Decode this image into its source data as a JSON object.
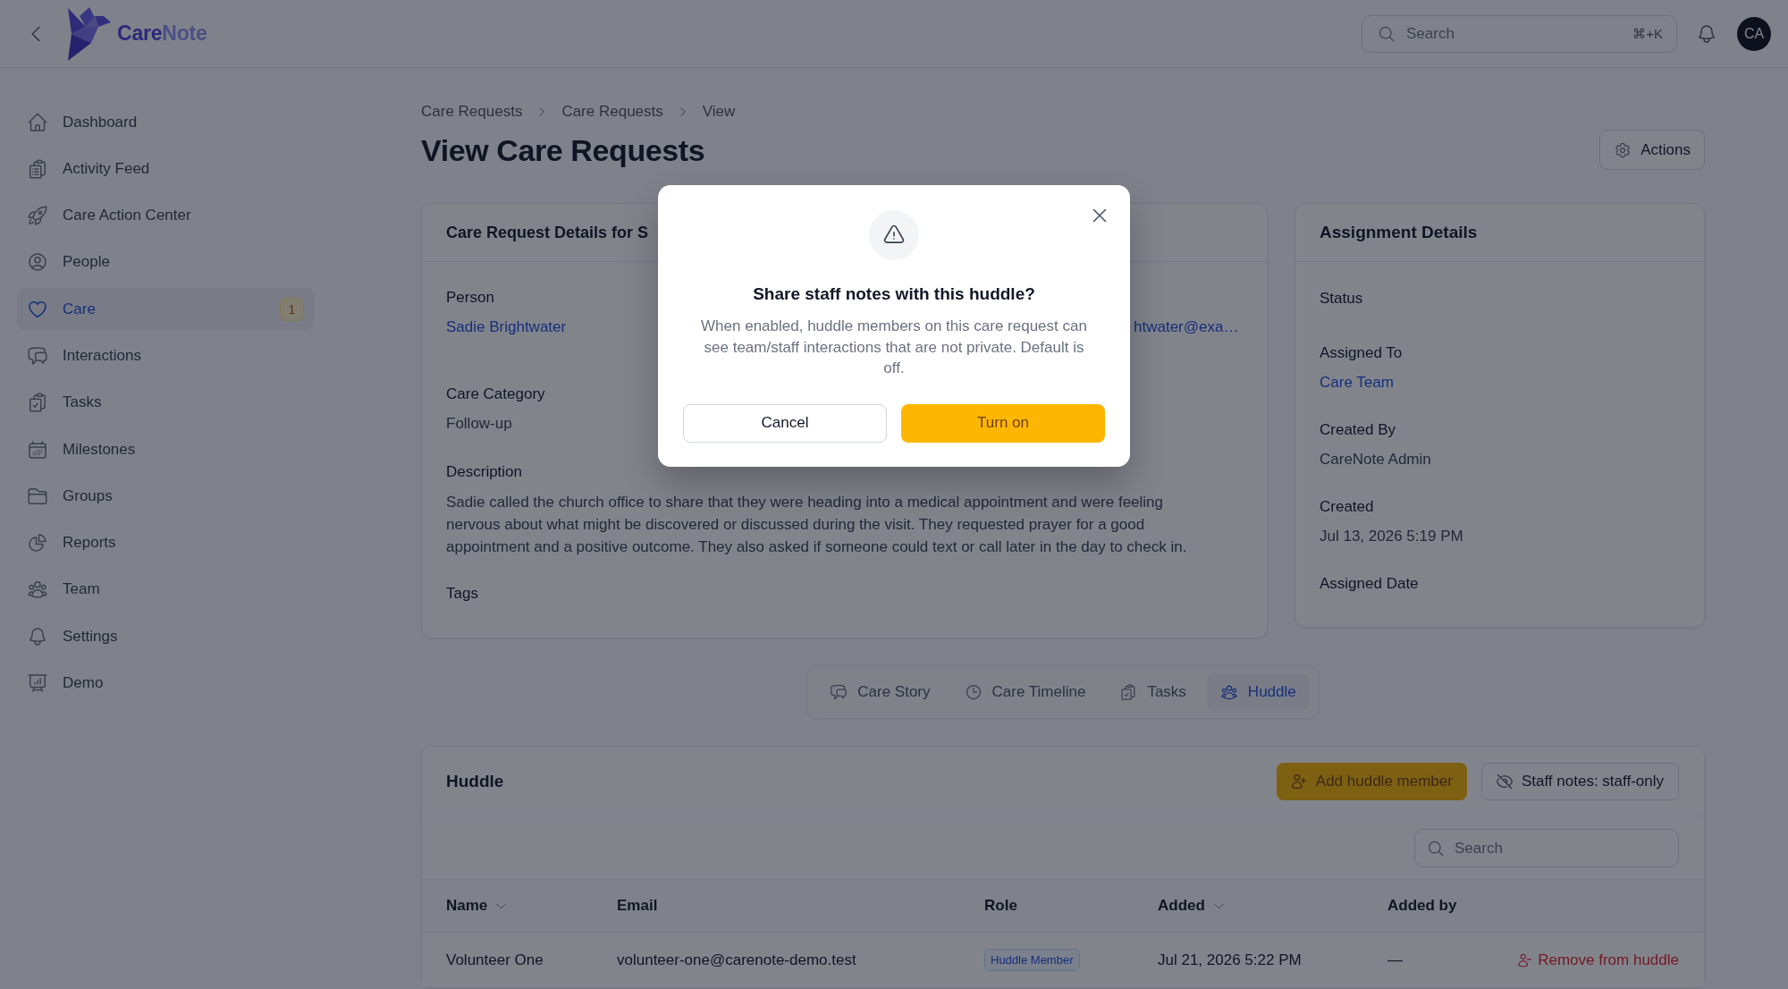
{
  "header": {
    "logo": {
      "parts": [
        "Care",
        "Note"
      ]
    },
    "search": {
      "placeholder": "Search",
      "shortcut": "⌘+K"
    },
    "avatar": "CA"
  },
  "sidebar": {
    "items": [
      {
        "label": "Dashboard",
        "selected": false
      },
      {
        "label": "Activity Feed",
        "selected": false
      },
      {
        "label": "Care Action Center",
        "selected": false
      },
      {
        "label": "People",
        "selected": false
      },
      {
        "label": "Care",
        "selected": true,
        "badge": "1"
      },
      {
        "label": "Interactions",
        "selected": false
      },
      {
        "label": "Tasks",
        "selected": false
      },
      {
        "label": "Milestones",
        "selected": false
      },
      {
        "label": "Groups",
        "selected": false
      },
      {
        "label": "Reports",
        "selected": false
      },
      {
        "label": "Team",
        "selected": false
      },
      {
        "label": "Settings",
        "selected": false
      },
      {
        "label": "Demo",
        "selected": false
      }
    ]
  },
  "breadcrumbs": [
    "Care Requests",
    "Care Requests",
    "View"
  ],
  "page_title": "View Care Requests",
  "actions_button": "Actions",
  "details_card": {
    "title": "Care Request Details for S",
    "person": {
      "label": "Person",
      "value": "Sadie Brightwater"
    },
    "email_fragment": "htwater@exa…",
    "care_category": {
      "label": "Care Category",
      "value": "Follow-up"
    },
    "description": {
      "label": "Description",
      "value": "Sadie called the church office to share that they were heading into a medical appointment and were feeling nervous about what might be discovered or discussed during the visit. They requested prayer for a good appointment and a positive outcome. They also asked if someone could text or call later in the day to check in."
    },
    "tags_label": "Tags"
  },
  "assignment_card": {
    "title": "Assignment Details",
    "fields": [
      {
        "label": "Status",
        "kind": "empty"
      },
      {
        "label": "Assigned To",
        "value": "Care Team",
        "kind": "link"
      },
      {
        "label": "Created By",
        "value": "CareNote Admin",
        "kind": "text"
      },
      {
        "label": "Created",
        "value": "Jul 13, 2026 5:19 PM",
        "kind": "text"
      },
      {
        "label": "Assigned Date",
        "kind": "empty"
      }
    ]
  },
  "tabs": {
    "items": [
      {
        "label": "Care Story",
        "selected": false
      },
      {
        "label": "Care Timeline",
        "selected": false
      },
      {
        "label": "Tasks",
        "selected": false
      },
      {
        "label": "Huddle",
        "selected": true
      }
    ]
  },
  "huddle": {
    "title": "Huddle",
    "add_button": "Add huddle member",
    "staff_notes_button": "Staff notes: staff-only",
    "search": {
      "placeholder": "Search"
    },
    "table": {
      "columns": [
        {
          "label": "Name",
          "sortable": true
        },
        {
          "label": "Email",
          "sortable": false
        },
        {
          "label": "Role",
          "sortable": false
        },
        {
          "label": "Added",
          "sortable": true
        },
        {
          "label": "Added by",
          "sortable": false
        }
      ],
      "rows": [
        {
          "name": "Volunteer One",
          "email": "volunteer-one@carenote-demo.test",
          "role": "Huddle Member",
          "added": "Jul 21, 2026 5:22 PM",
          "added_by": "—",
          "action": "Remove from huddle"
        }
      ]
    }
  },
  "modal": {
    "title": "Share staff notes with this huddle?",
    "message": "When enabled, huddle members on this care request can see team/staff interactions that are not private. Default is off.",
    "cancel": "Cancel",
    "confirm": "Turn on"
  }
}
